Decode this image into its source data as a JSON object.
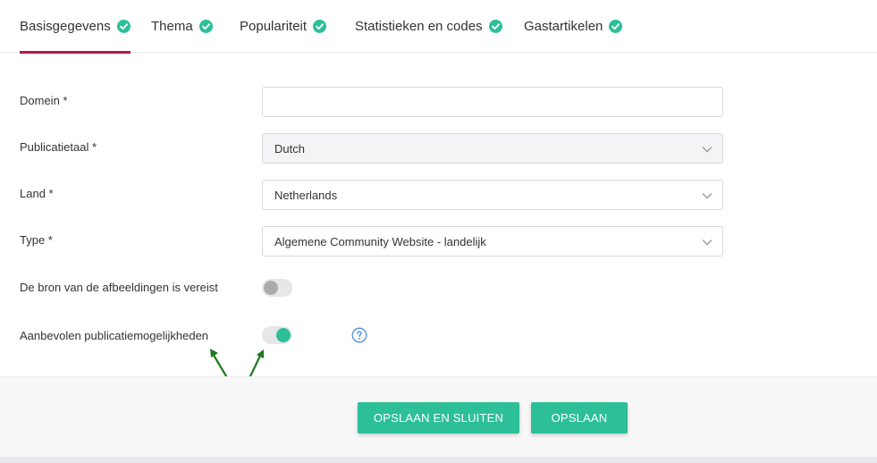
{
  "tabs": [
    {
      "label": "Basisgegevens",
      "completed": true,
      "active": true
    },
    {
      "label": "Thema",
      "completed": true,
      "active": false
    },
    {
      "label": "Populariteit",
      "completed": true,
      "active": false
    },
    {
      "label": "Statistieken en codes",
      "completed": true,
      "active": false
    },
    {
      "label": "Gastartikelen",
      "completed": true,
      "active": false
    }
  ],
  "form": {
    "domain": {
      "label": "Domein *",
      "value": "",
      "placeholder": ""
    },
    "language": {
      "label": "Publicatietaal *",
      "value": "Dutch",
      "disabled": true
    },
    "country": {
      "label": "Land *",
      "value": "Netherlands"
    },
    "type": {
      "label": "Type *",
      "value": "Algemene Community Website - landelijk"
    },
    "image_source": {
      "label": "De bron van de afbeeldingen is vereist",
      "enabled": false
    },
    "recommended": {
      "label": "Aanbevolen publicatiemogelijkheden",
      "enabled": true
    }
  },
  "buttons": {
    "save_close": "OPSLAAN EN SLUITEN",
    "save": "OPSLAAN"
  },
  "colors": {
    "accent": "#2dbf98",
    "tab_underline": "#b5174f",
    "help": "#4a90e2",
    "annotation_arrow": "#1f7a1f"
  },
  "icons": {
    "tab_status": "check-circle-icon",
    "select": "chevron-down-icon",
    "help": "question-circle-icon"
  }
}
